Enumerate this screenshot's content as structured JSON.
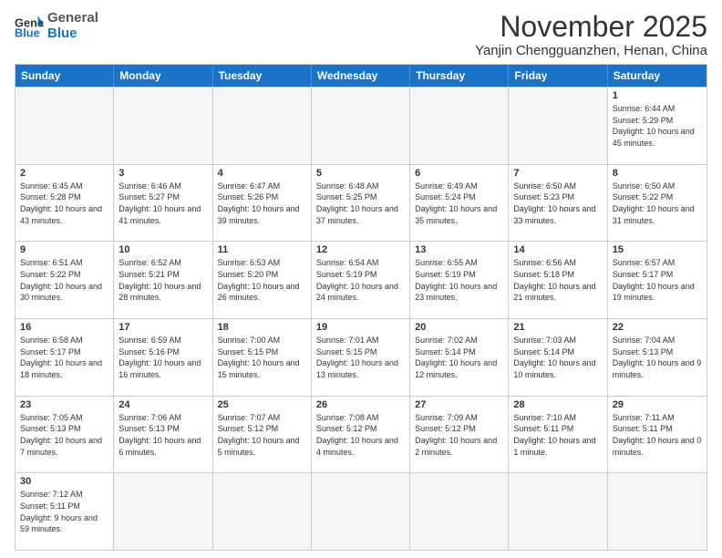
{
  "header": {
    "logo_general": "General",
    "logo_blue": "Blue",
    "month_title": "November 2025",
    "location": "Yanjin Chengguanzhen, Henan, China"
  },
  "calendar": {
    "days_of_week": [
      "Sunday",
      "Monday",
      "Tuesday",
      "Wednesday",
      "Thursday",
      "Friday",
      "Saturday"
    ],
    "weeks": [
      [
        {
          "day": "",
          "empty": true
        },
        {
          "day": "",
          "empty": true
        },
        {
          "day": "",
          "empty": true
        },
        {
          "day": "",
          "empty": true
        },
        {
          "day": "",
          "empty": true
        },
        {
          "day": "",
          "empty": true
        },
        {
          "day": "1",
          "sunrise": "6:44 AM",
          "sunset": "5:29 PM",
          "daylight": "10 hours and 45 minutes."
        }
      ],
      [
        {
          "day": "2",
          "sunrise": "6:45 AM",
          "sunset": "5:28 PM",
          "daylight": "10 hours and 43 minutes."
        },
        {
          "day": "3",
          "sunrise": "6:46 AM",
          "sunset": "5:27 PM",
          "daylight": "10 hours and 41 minutes."
        },
        {
          "day": "4",
          "sunrise": "6:47 AM",
          "sunset": "5:26 PM",
          "daylight": "10 hours and 39 minutes."
        },
        {
          "day": "5",
          "sunrise": "6:48 AM",
          "sunset": "5:25 PM",
          "daylight": "10 hours and 37 minutes."
        },
        {
          "day": "6",
          "sunrise": "6:49 AM",
          "sunset": "5:24 PM",
          "daylight": "10 hours and 35 minutes."
        },
        {
          "day": "7",
          "sunrise": "6:50 AM",
          "sunset": "5:23 PM",
          "daylight": "10 hours and 33 minutes."
        },
        {
          "day": "8",
          "sunrise": "6:50 AM",
          "sunset": "5:22 PM",
          "daylight": "10 hours and 31 minutes."
        }
      ],
      [
        {
          "day": "9",
          "sunrise": "6:51 AM",
          "sunset": "5:22 PM",
          "daylight": "10 hours and 30 minutes."
        },
        {
          "day": "10",
          "sunrise": "6:52 AM",
          "sunset": "5:21 PM",
          "daylight": "10 hours and 28 minutes."
        },
        {
          "day": "11",
          "sunrise": "6:53 AM",
          "sunset": "5:20 PM",
          "daylight": "10 hours and 26 minutes."
        },
        {
          "day": "12",
          "sunrise": "6:54 AM",
          "sunset": "5:19 PM",
          "daylight": "10 hours and 24 minutes."
        },
        {
          "day": "13",
          "sunrise": "6:55 AM",
          "sunset": "5:19 PM",
          "daylight": "10 hours and 23 minutes."
        },
        {
          "day": "14",
          "sunrise": "6:56 AM",
          "sunset": "5:18 PM",
          "daylight": "10 hours and 21 minutes."
        },
        {
          "day": "15",
          "sunrise": "6:57 AM",
          "sunset": "5:17 PM",
          "daylight": "10 hours and 19 minutes."
        }
      ],
      [
        {
          "day": "16",
          "sunrise": "6:58 AM",
          "sunset": "5:17 PM",
          "daylight": "10 hours and 18 minutes."
        },
        {
          "day": "17",
          "sunrise": "6:59 AM",
          "sunset": "5:16 PM",
          "daylight": "10 hours and 16 minutes."
        },
        {
          "day": "18",
          "sunrise": "7:00 AM",
          "sunset": "5:15 PM",
          "daylight": "10 hours and 15 minutes."
        },
        {
          "day": "19",
          "sunrise": "7:01 AM",
          "sunset": "5:15 PM",
          "daylight": "10 hours and 13 minutes."
        },
        {
          "day": "20",
          "sunrise": "7:02 AM",
          "sunset": "5:14 PM",
          "daylight": "10 hours and 12 minutes."
        },
        {
          "day": "21",
          "sunrise": "7:03 AM",
          "sunset": "5:14 PM",
          "daylight": "10 hours and 10 minutes."
        },
        {
          "day": "22",
          "sunrise": "7:04 AM",
          "sunset": "5:13 PM",
          "daylight": "10 hours and 9 minutes."
        }
      ],
      [
        {
          "day": "23",
          "sunrise": "7:05 AM",
          "sunset": "5:13 PM",
          "daylight": "10 hours and 7 minutes."
        },
        {
          "day": "24",
          "sunrise": "7:06 AM",
          "sunset": "5:13 PM",
          "daylight": "10 hours and 6 minutes."
        },
        {
          "day": "25",
          "sunrise": "7:07 AM",
          "sunset": "5:12 PM",
          "daylight": "10 hours and 5 minutes."
        },
        {
          "day": "26",
          "sunrise": "7:08 AM",
          "sunset": "5:12 PM",
          "daylight": "10 hours and 4 minutes."
        },
        {
          "day": "27",
          "sunrise": "7:09 AM",
          "sunset": "5:12 PM",
          "daylight": "10 hours and 2 minutes."
        },
        {
          "day": "28",
          "sunrise": "7:10 AM",
          "sunset": "5:11 PM",
          "daylight": "10 hours and 1 minute."
        },
        {
          "day": "29",
          "sunrise": "7:11 AM",
          "sunset": "5:11 PM",
          "daylight": "10 hours and 0 minutes."
        }
      ],
      [
        {
          "day": "30",
          "sunrise": "7:12 AM",
          "sunset": "5:11 PM",
          "daylight": "9 hours and 59 minutes."
        },
        {
          "day": "",
          "empty": true
        },
        {
          "day": "",
          "empty": true
        },
        {
          "day": "",
          "empty": true
        },
        {
          "day": "",
          "empty": true
        },
        {
          "day": "",
          "empty": true
        },
        {
          "day": "",
          "empty": true
        }
      ]
    ]
  }
}
